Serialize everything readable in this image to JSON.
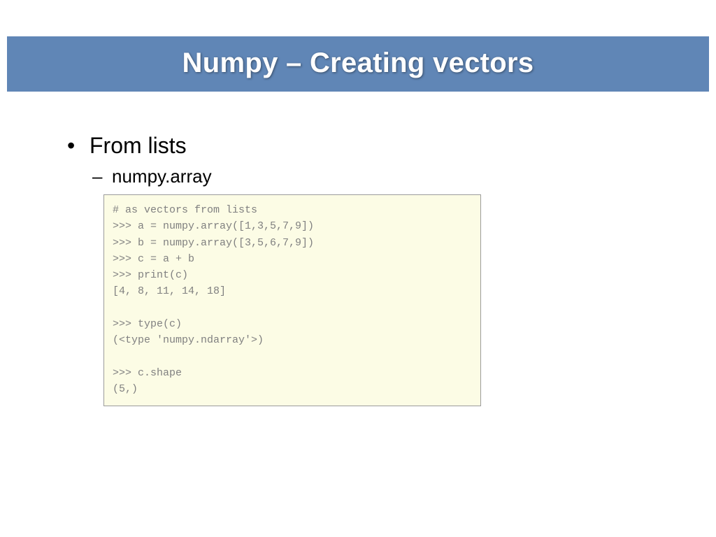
{
  "title": "Numpy – Creating vectors",
  "bullets": {
    "top": "From lists",
    "sub": "numpy.array"
  },
  "code": "# as vectors from lists\n>>> a = numpy.array([1,3,5,7,9])\n>>> b = numpy.array([3,5,6,7,9])\n>>> c = a + b\n>>> print(c)\n[4, 8, 11, 14, 18]\n\n>>> type(c)\n(<type 'numpy.ndarray'>)\n\n>>> c.shape\n(5,)"
}
